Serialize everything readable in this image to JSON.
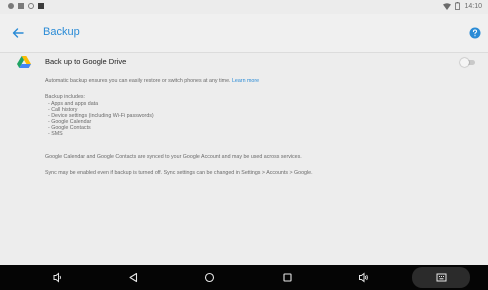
{
  "status_bar": {
    "time": "14:10"
  },
  "app_bar": {
    "title": "Backup"
  },
  "setting": {
    "title": "Back up to Google Drive",
    "toggle_on": false
  },
  "body": {
    "intro": "Automatic backup ensures you can easily restore or switch phones at any time.",
    "learn_more": "Learn more",
    "includes_heading": "Backup includes:",
    "includes_items": [
      "- Apps and apps data",
      "- Call history",
      "- Device settings (including Wi-Fi passwords)",
      "- Google Calendar",
      "- Google Contacts",
      "- SMS"
    ],
    "sync_note": "Google Calendar and Google Contacts are synced to your Google Account and may be used across services.",
    "sync_settings_note": "Sync may be enabled even if backup is turned off. Sync settings can be changed in Settings > Accounts > Google."
  },
  "colors": {
    "accent": "#2a8bd6",
    "background": "#ededed",
    "nav_bar": "#050505"
  }
}
